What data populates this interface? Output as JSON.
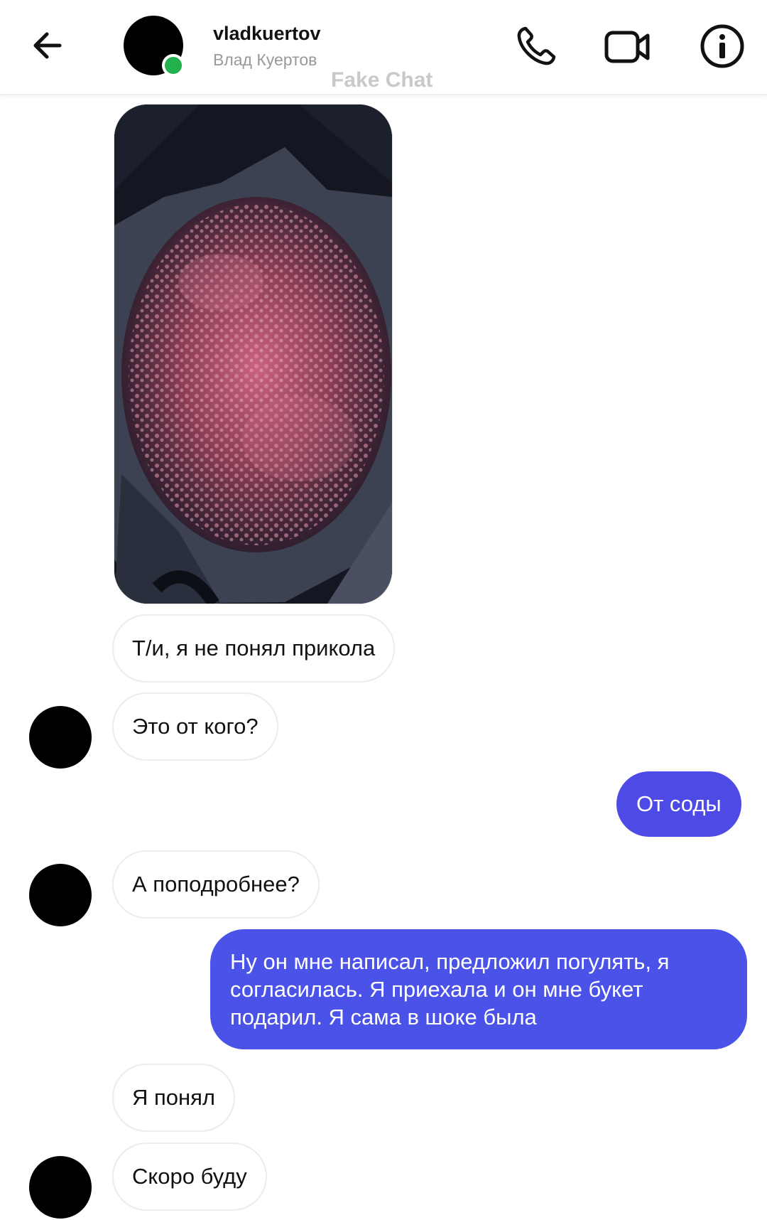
{
  "header": {
    "username": "vladkuertov",
    "full_name": "Влад Куертов",
    "watermark": "Fake Chat",
    "icons": [
      "back-arrow-icon",
      "phone-icon",
      "video-camera-icon",
      "info-icon"
    ],
    "online_color": "#22b14c"
  },
  "theme": {
    "outgoing_bubble": "#4e4ae6",
    "incoming_bubble_border": "#ececec"
  },
  "messages": [
    {
      "type": "photo",
      "sender": "them",
      "description_icon": "photo-attachment"
    },
    {
      "type": "text",
      "sender": "them",
      "text": "Т/и, я не понял прикола"
    },
    {
      "type": "text",
      "sender": "them",
      "text": "Это от кого?"
    },
    {
      "type": "text",
      "sender": "me",
      "text": "От соды"
    },
    {
      "type": "text",
      "sender": "them",
      "text": "А поподробнее?"
    },
    {
      "type": "text",
      "sender": "me",
      "text": "Ну он мне написал, предложил погулять, я согласилась. Я приехала и он мне букет подарил. Я сама в шоке была"
    },
    {
      "type": "text",
      "sender": "them",
      "text": "Я понял"
    },
    {
      "type": "text",
      "sender": "them",
      "text": "Скоро буду"
    }
  ]
}
